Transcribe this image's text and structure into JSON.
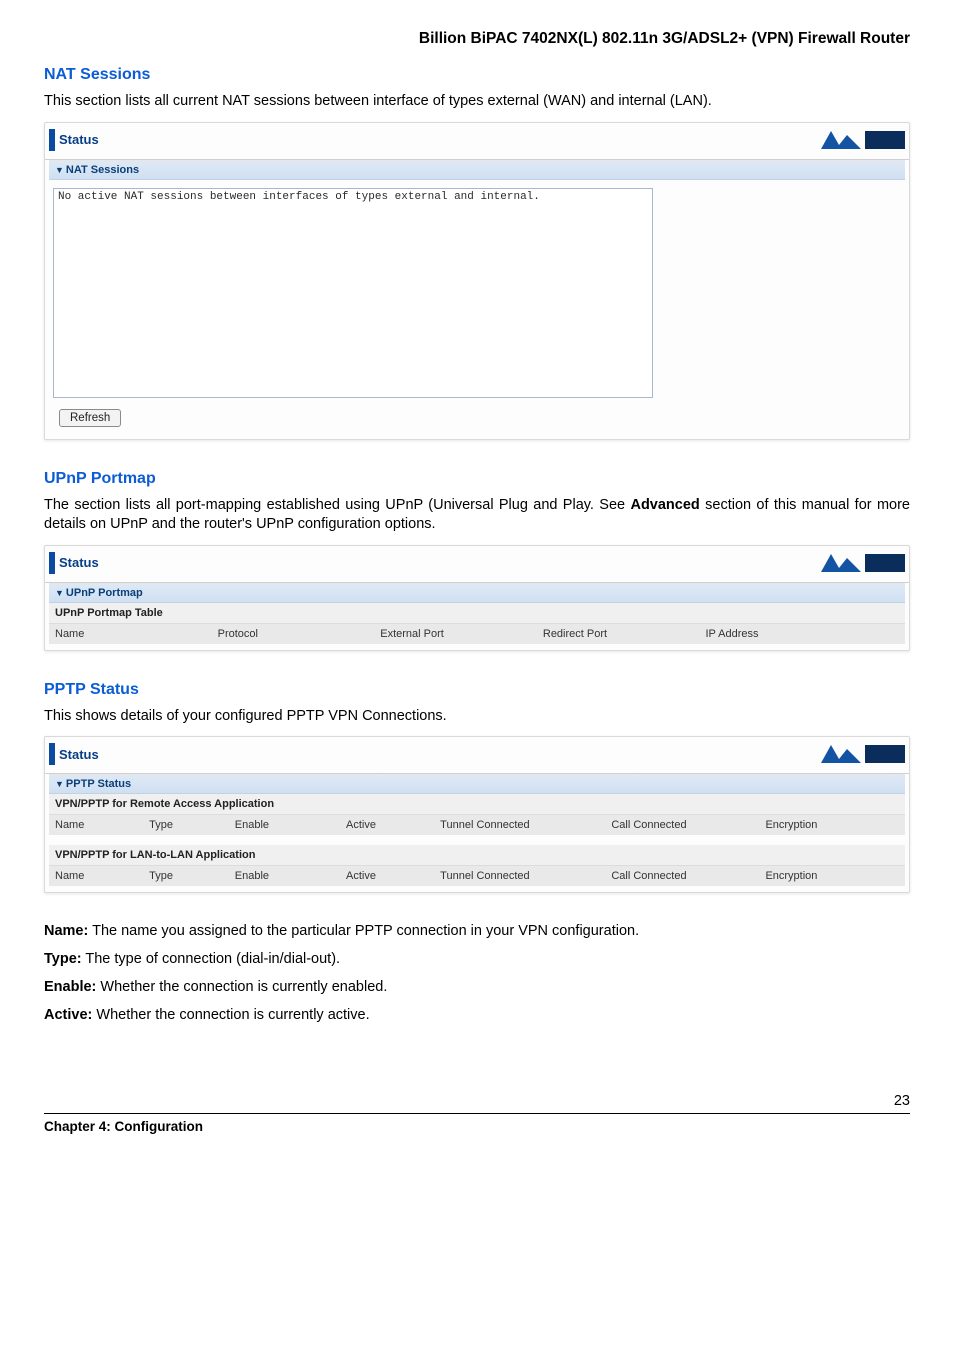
{
  "doc_title": "Billion BiPAC 7402NX(L) 802.11n 3G/ADSL2+ (VPN) Firewall Router",
  "sections": {
    "nat": {
      "heading": "NAT Sessions",
      "desc": "This section lists all current NAT sessions between interface of types external (WAN) and internal (LAN).",
      "panel_title": "Status",
      "subheader": "NAT Sessions",
      "textarea_content": "No active NAT sessions between interfaces of types external and internal.",
      "refresh": "Refresh"
    },
    "upnp": {
      "heading": "UPnP Portmap",
      "desc_pre": "The section lists all port-mapping established using UPnP (Universal Plug and Play. See ",
      "desc_bold": "Advanced",
      "desc_post": " section of this manual for more details on UPnP and the router's UPnP configuration options.",
      "panel_title": "Status",
      "subheader": "UPnP Portmap",
      "table_title": "UPnP Portmap Table",
      "columns": [
        "Name",
        "Protocol",
        "External Port",
        "Redirect Port",
        "IP Address"
      ]
    },
    "pptp": {
      "heading": "PPTP Status",
      "desc": "This shows details of your configured PPTP VPN Connections.",
      "panel_title": "Status",
      "subheader": "PPTP Status",
      "remote_title": "VPN/PPTP for Remote Access Application",
      "lan_title": "VPN/PPTP for LAN-to-LAN Application",
      "columns": [
        "Name",
        "Type",
        "Enable",
        "Active",
        "Tunnel Connected",
        "Call Connected",
        "Encryption"
      ]
    }
  },
  "defs": {
    "name_label": "Name:",
    "name_text": " The name you assigned to the particular PPTP connection in your VPN configuration.",
    "type_label": "Type:",
    "type_text": " The type of connection (dial-in/dial-out).",
    "enable_label": "Enable:",
    "enable_text": " Whether the connection is currently enabled.",
    "active_label": "Active:",
    "active_text": " Whether the connection is currently active."
  },
  "page_number": "23",
  "chapter": "Chapter 4: Configuration"
}
